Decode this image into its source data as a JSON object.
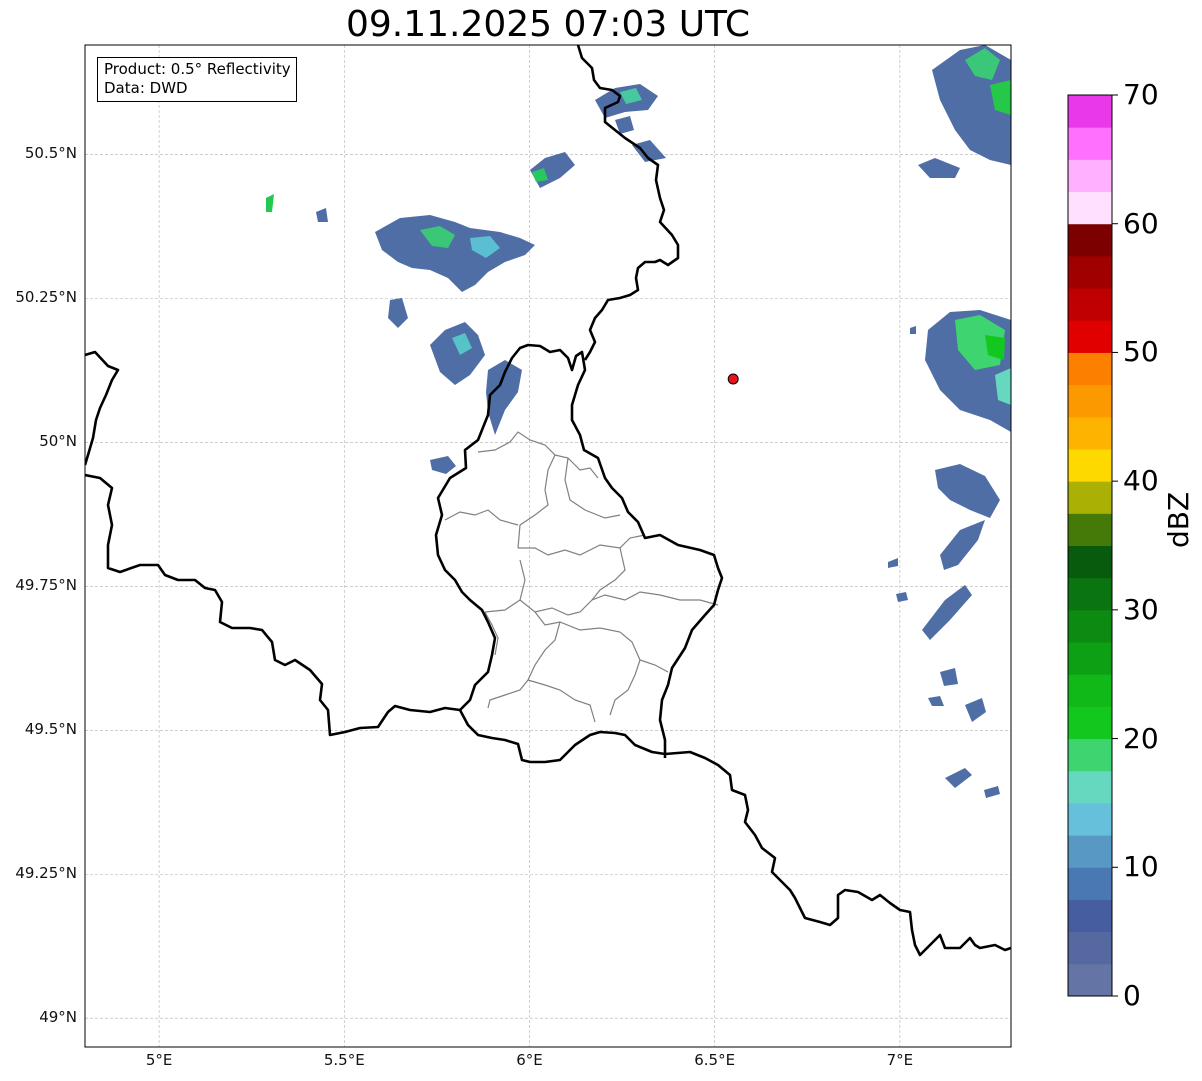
{
  "title": "09.11.2025 07:03 UTC",
  "info_box": {
    "product": "Product: 0.5° Reflectivity",
    "data": "Data: DWD"
  },
  "map": {
    "lon_range": [
      4.8,
      7.3
    ],
    "lat_range": [
      48.95,
      50.69
    ],
    "x_ticks": [
      {
        "lon": 5.0,
        "label": "5°E"
      },
      {
        "lon": 5.5,
        "label": "5.5°E"
      },
      {
        "lon": 6.0,
        "label": "6°E"
      },
      {
        "lon": 6.5,
        "label": "6.5°E"
      },
      {
        "lon": 7.0,
        "label": "7°E"
      }
    ],
    "y_ticks": [
      {
        "lat": 50.5,
        "label": "50.5°N"
      },
      {
        "lat": 50.25,
        "label": "50.25°N"
      },
      {
        "lat": 50.0,
        "label": "50°N"
      },
      {
        "lat": 49.75,
        "label": "49.75°N"
      },
      {
        "lat": 49.5,
        "label": "49.5°N"
      },
      {
        "lat": 49.25,
        "label": "49.25°N"
      },
      {
        "lat": 49.0,
        "label": "49°N"
      }
    ],
    "gridlines": "dashed",
    "marker": {
      "lon": 6.55,
      "lat": 50.11,
      "color": "#e8141c"
    },
    "country_border_color": "#000000",
    "district_border_color": "#808080"
  },
  "colorbar": {
    "label": "dBZ",
    "min": 0,
    "max": 70,
    "ticks": [
      {
        "value": 0,
        "label": "0"
      },
      {
        "value": 10,
        "label": "10"
      },
      {
        "value": 20,
        "label": "20"
      },
      {
        "value": 30,
        "label": "30"
      },
      {
        "value": 40,
        "label": "40"
      },
      {
        "value": 50,
        "label": "50"
      },
      {
        "value": 60,
        "label": "60"
      },
      {
        "value": 70,
        "label": "70"
      }
    ],
    "colors": [
      "#6474a4",
      "#5568a0",
      "#465ea0",
      "#4a78b2",
      "#5898c4",
      "#66c0dc",
      "#66d8c0",
      "#3ed470",
      "#12c81e",
      "#10b818",
      "#0ea014",
      "#0c8a12",
      "#0a7410",
      "#085a0c",
      "#467a08",
      "#aab004",
      "#fed900",
      "#fdb300",
      "#fd9900",
      "#fd7f00",
      "#e00000",
      "#c00000",
      "#a00000",
      "#7c0000",
      "#ffe0ff",
      "#ffb0ff",
      "#ff70ff",
      "#e838e8"
    ]
  }
}
